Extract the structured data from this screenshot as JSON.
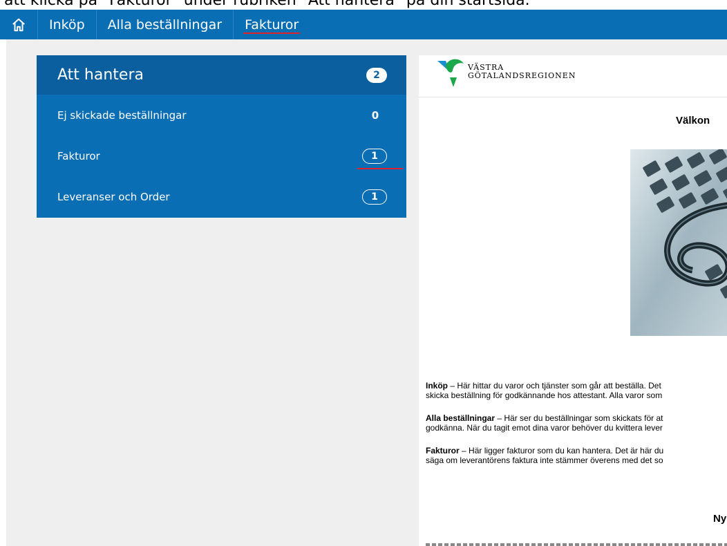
{
  "caption": "att klicka på \"Fakturor\" under rubriken \"Att hantera\" på din startsida.",
  "nav": {
    "home_icon": "home-icon",
    "items": [
      {
        "label": "Inköp"
      },
      {
        "label": "Alla beställningar"
      },
      {
        "label": "Fakturor",
        "active": true
      }
    ]
  },
  "panel": {
    "title": "Att hantera",
    "total": "2",
    "rows": [
      {
        "label": "Ej skickade beställningar",
        "count": "0"
      },
      {
        "label": "Fakturor",
        "count": "1"
      },
      {
        "label": "Leveranser och Order",
        "count": "1"
      }
    ]
  },
  "doc": {
    "logo_line1": "VÄSTRA",
    "logo_line2": "GÖTALANDSREGIONEN",
    "welcome": "Välkon",
    "paragraphs": [
      {
        "bold": "Inköp",
        "line1": " – Här hittar du varor och tjänster som går att beställa. Det",
        "line2": "skicka beställning för godkännande hos attestant. Alla varor som"
      },
      {
        "bold": "Alla beställningar",
        "line1": " – Här ser du beställningar som skickats för at",
        "line2": "godkänna. När du tagit emot dina varor behöver du kvittera lever"
      },
      {
        "bold": "Fakturor",
        "line1": " – Här ligger fakturor som du kan hantera. Det är här du",
        "line2": "säga om leverantörens faktura inte stämmer överens med det so"
      }
    ],
    "ny": "Ny"
  },
  "colors": {
    "nav_bg": "#0a6eb4",
    "panel_head": "#0b5f9e",
    "accent_red": "#e0202a"
  }
}
